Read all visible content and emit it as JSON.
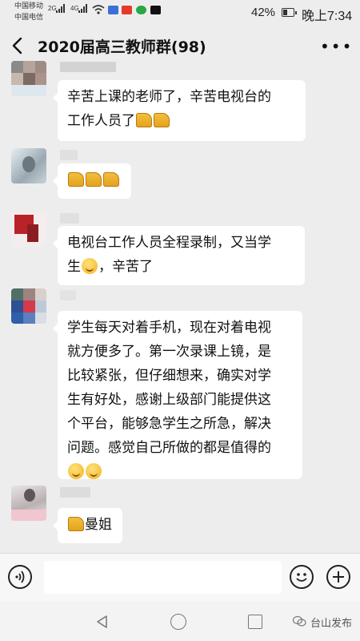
{
  "statusbar": {
    "carrier1": "中国移动",
    "carrier2": "中国电信",
    "net1": "2G",
    "net2": "4G",
    "battery": "42%",
    "battery_level": 0.42,
    "time": "晚上7:34"
  },
  "header": {
    "title": "2020届高三教师群(98)"
  },
  "messages": [
    {
      "segments": [
        {
          "t": "text",
          "v": "辛苦上课的老师了，辛苦电视台的\n工作人员了"
        },
        {
          "t": "icon",
          "v": "thumbs-up-icon"
        },
        {
          "t": "icon",
          "v": "thumbs-up-icon"
        }
      ]
    },
    {
      "segments": [
        {
          "t": "icon",
          "v": "thumbs-up-icon"
        },
        {
          "t": "icon",
          "v": "thumbs-up-icon"
        },
        {
          "t": "icon",
          "v": "thumbs-up-icon"
        }
      ]
    },
    {
      "segments": [
        {
          "t": "text",
          "v": "电视台工作人员全程录制，又当学\n生"
        },
        {
          "t": "icon",
          "v": "grin-emoji-icon"
        },
        {
          "t": "text",
          "v": "，辛苦了"
        }
      ]
    },
    {
      "segments": [
        {
          "t": "text",
          "v": "学生每天对着手机，现在对着电视\n就方便多了。第一次录课上镜，是\n比较紧张，但仔细想来，确实对学\n生有好处，感谢上级部门能提供这\n个平台，能够急学生之所急，解决\n问题。感觉自己所做的都是值得的\n"
        },
        {
          "t": "icon",
          "v": "smile-emoji-icon"
        },
        {
          "t": "icon",
          "v": "tongue-emoji-icon"
        }
      ]
    },
    {
      "segments": [
        {
          "t": "icon",
          "v": "thumbs-up-icon"
        },
        {
          "t": "text",
          "v": "曼姐"
        }
      ]
    }
  ],
  "watermark": "台山发布",
  "colors": {
    "background": "#ededed",
    "bubble": "#ffffff",
    "emoji": "#f0b321"
  }
}
